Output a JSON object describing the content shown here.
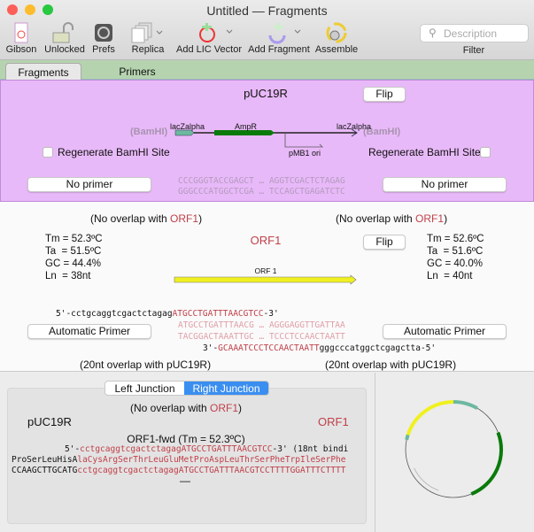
{
  "window": {
    "title": "Untitled — Fragments"
  },
  "toolbar": {
    "items": [
      {
        "label": "Gibson",
        "icon": "gibson-icon"
      },
      {
        "label": "Unlocked",
        "icon": "unlocked-lock-icon"
      },
      {
        "label": "Prefs",
        "icon": "gear-icon"
      },
      {
        "label": "Replica",
        "icon": "replica-icon"
      },
      {
        "label": "Add LIC Vector",
        "icon": "add-vector-icon"
      },
      {
        "label": "Add Fragment",
        "icon": "add-fragment-icon"
      },
      {
        "label": "Assemble",
        "icon": "assemble-icon"
      }
    ],
    "search_placeholder": "Description",
    "filter_label": "Filter"
  },
  "tabs": [
    {
      "label": "Fragments",
      "active": true
    },
    {
      "label": "Primers",
      "active": false
    }
  ],
  "vector": {
    "name": "pUC19R",
    "flip": "Flip",
    "features": {
      "lac1": "lacZalpha",
      "ampr": "AmpR",
      "lac2": "lacZalpha",
      "ori": "pMB1 ori"
    },
    "left_site": "(BamHI)",
    "right_site": "(BamHI)",
    "regen_left": "Regenerate BamHI Site",
    "regen_right": "Regenerate BamHI Site",
    "left_primer": "No primer",
    "right_primer": "No primer",
    "seq_top": "CCCGGGTACCGAGCT … AGGTCGACTCTAGAG",
    "seq_bottom": "GGGCCCATGGCTCGA … TCCAGCTGAGATCTC",
    "left_overlap_pre": "(No overlap with ",
    "right_overlap_pre": "(No overlap with ",
    "overlap_target": "ORF1",
    "overlap_post": ")"
  },
  "fragment": {
    "name": "ORF1",
    "flip": "Flip",
    "feature": "ORF 1",
    "left_stats": "Tm = 52.3ºC\nTa  = 51.5ºC\nGC = 44.4%\nLn  = 38nt",
    "right_stats": "Tm = 52.6ºC\nTa  = 51.6ºC\nGC = 40.0%\nLn  = 40nt",
    "fwd_pre": "5'-cctgcaggtcgactctagag",
    "fwd_bind": "ATGCCTGATTTAACGTCC",
    "fwd_post": "-3'",
    "seq_top": "ATGCCTGATTTAACG … AGGGAGGTTGATTAA",
    "seq_bottom": "TACGGACTAAATTGC … TCCCTCCAACTAATT",
    "rev_pre": "3'-",
    "rev_bind": "GCAAATCCCTCCAACTAATT",
    "rev_post": "gggcccatggctcgagctta-5'",
    "left_primer": "Automatic Primer",
    "right_primer": "Automatic Primer",
    "left_overlap": "(20nt overlap with pUC19R)",
    "right_overlap": "(20nt overlap with pUC19R)"
  },
  "junction": {
    "tabs": [
      {
        "label": "Left Junction",
        "active": false
      },
      {
        "label": "Right Junction",
        "active": true
      }
    ],
    "overlap_pre": "(No overlap with ",
    "overlap_target": "ORF1",
    "overlap_post": ")",
    "left_name": "pUC19R",
    "right_name": "ORF1",
    "primer_title": "ORF1-fwd (Tm = 52.3ºC)",
    "primer_5": "5'-",
    "primer_tail": "cctgcaggtcgactctagag",
    "primer_bind": "ATGCCTGATTTAACGTCC",
    "primer_3": "-3' (18nt bindi",
    "aa_black": "ProSerLeuHisA",
    "aa_red": "laCysArgSerThrLeuGluMetProAspLeuThrSerPheTrpIleSerPhe",
    "dna_black": "CCAAGCTTGCATG",
    "dna_red": "cctgcaggtcgactctagagATGCCTGATTTAACGTCCTTTTGGATTTCTTTT",
    "dash": "—"
  },
  "colors": {
    "vector_bg": "#e8b9f8",
    "tab_bar": "#b5d3af",
    "accent_red": "#c0404a",
    "selected_tab": "#3a8ef0",
    "orf_yellow": "#f0f020",
    "ampr_green": "#0a7a0a",
    "lac_teal": "#6cb8a0"
  }
}
